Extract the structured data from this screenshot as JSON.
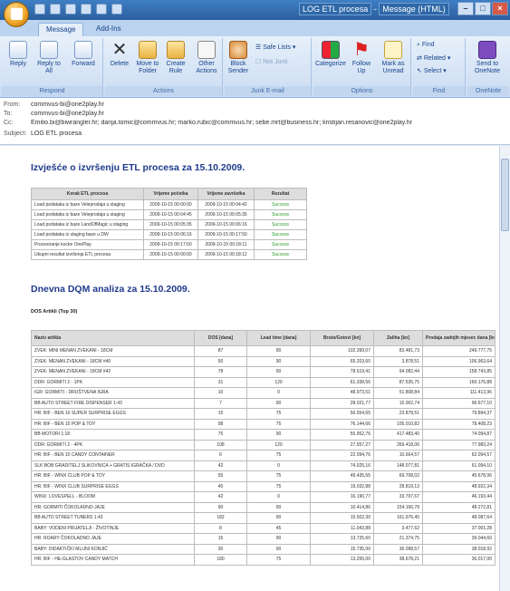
{
  "window": {
    "title": "LOG ETL procesa",
    "title_suffix": "Message (HTML)"
  },
  "tabs": [
    {
      "label": "Message"
    },
    {
      "label": "Add-Ins"
    }
  ],
  "ribbon": {
    "groups": {
      "respond": "Respond",
      "actions": "Actions",
      "junk": "Junk E-mail",
      "options": "Options",
      "find": "Find",
      "onenote": "OneNote"
    },
    "buttons": {
      "reply": "Reply",
      "reply_all": "Reply to All",
      "forward": "Forward",
      "delete": "Delete",
      "move_to_folder": "Move to Folder",
      "create_rule": "Create Rule",
      "other_actions": "Other Actions",
      "block_sender": "Block Sender",
      "safe_lists": "Safe Lists",
      "not_junk": "Not Junk",
      "categorize": "Categorize",
      "follow_up": "Follow Up",
      "mark_as_unread": "Mark as Unread",
      "find": "Find",
      "related": "Related",
      "select": "Select",
      "send_to_onenote": "Send to OneNote"
    }
  },
  "header": {
    "from_label": "From:",
    "from": "commvus-bi@one2play.hr",
    "to_label": "To:",
    "to": "commvus-bi@one2play.hr",
    "cc_label": "Cc:",
    "cc": "Emilio.bi@biwrangler.hr; darija.tomic@commvus.hr; marko.rubic@commvus.hr; sebe.mrt@business.hr; kristijan.resanovic@one2play.hr",
    "subject_label": "Subject:",
    "subject": "LOG ETL procesa"
  },
  "etl": {
    "title": "Izvješće o izvršenju ETL procesa za 15.10.2009.",
    "columns": [
      "Korak ETL procesa",
      "Vrijeme početka",
      "Vrijeme završetka",
      "Rezultat"
    ],
    "rows": [
      [
        "Load podataka iz baze Veleprodaja u staging",
        "2009-10-15 00:00:00",
        "2009-10-15 00:04:42",
        "Success"
      ],
      [
        "Load podataka iz baze Veleprodaja u staging",
        "2009-10-15 00:04:45",
        "2009-10-15 00:05:35",
        "Success"
      ],
      [
        "Load podataka iz baze LandOfMagic u staging",
        "2009-10-15 00:05:35",
        "2009-10-15 00:06:16",
        "Success"
      ],
      [
        "Load podataka iz staging baze u DW",
        "2009-10-15 00:06:16",
        "2009-10-15 00:17:50",
        "Success"
      ],
      [
        "Procesiranje kocke OnePlay",
        "2009-10-15 00:17:50",
        "2009-10-15 00:18:11",
        "Success"
      ],
      [
        "Ukupni rezultat izvršenja ETL procesa",
        "2009-10-15 00:00:00",
        "2009-10-15 00:18:12",
        "Success"
      ]
    ]
  },
  "dqm": {
    "title": "Dnevna DQM analiza za 15.10.2009.",
    "subtitle": "DOS Artikli (Top 30)",
    "columns": [
      "Naziv artikla",
      "DOS [dana]",
      "Lead time [dana]",
      "Bruto/Gotovi [kn]",
      "Zaliha [kn]",
      "Prodaja zadnjih mjesec dana [kn]"
    ],
    "rows": [
      [
        "ZVEK: MINI MENAN ZVEKANI - 18CM",
        "87",
        "90",
        "102.399,07",
        "83.481,73",
        "249.777,75"
      ],
      [
        "ZVEK: MENAN ZVEKANI - 18CM #40",
        "50",
        "90",
        "65.203,60",
        "3.878,51",
        "106.963,64"
      ],
      [
        "ZVEK: MENAN ZVEKANI - 18CM #42",
        "78",
        "90",
        "78.619,41",
        "94.082,44",
        "158.743,85"
      ],
      [
        "DDR: GORMITI 2 - 1PK",
        "31",
        "120",
        "61.338,56",
        "87.535,75",
        "160.176,88"
      ],
      [
        "IGR: GORMITI - DRUŠTVENA IGRA",
        "10",
        "0",
        "48.973,51",
        "51.808,84",
        "111.413,96"
      ],
      [
        "BB AUTO STREET FIRE DISPENSER 1:43",
        "7",
        "90",
        "28.021,77",
        "15.002,74",
        "96.677,10"
      ],
      [
        "HR: BIF - BEN 10 SUPER SURPRISE EGGS",
        "15",
        "75",
        "56.554,65",
        "23.878,51",
        "79.894,37"
      ],
      [
        "HR: BIF - BEN 10 POP & TOY",
        "98",
        "75",
        "76.144,66",
        "105.010,82",
        "78.408,23"
      ],
      [
        "BB MOTORI 1:18",
        "75",
        "90",
        "55.952,76",
        "417.483,40",
        "74.094,87"
      ],
      [
        "DDR: GORMITI 2 - 4PK",
        "108",
        "120",
        "27.557,27",
        "269.418,06",
        "77.983,24"
      ],
      [
        "HR: BIF - BEN 10 CANDY CONTAINER",
        "6",
        "75",
        "22.094,76",
        "10.664,57",
        "62.094,57"
      ],
      [
        "SLK BOB GRADITELJ SLIKOVNICA + GRATIS IGRAČKA / DVD",
        "42",
        "0",
        "74.925,16",
        "148.077,81",
        "61.094,10"
      ],
      [
        "HR: BIF - WINX CLUB POP & TOY",
        "55",
        "75",
        "49.435,55",
        "69.708,02",
        "45.678,96"
      ],
      [
        "HR: BIF - WINX CLUB SURPRISE EGGS",
        "40",
        "75",
        "19.032,88",
        "28.819,13",
        "48.922,34"
      ],
      [
        "WINX: LOVESPELL - BLOOM",
        "42",
        "0",
        "16.190,77",
        "33.797,67",
        "46.193,44"
      ],
      [
        "HR: GORMITI ČOKOLADNO JAJE",
        "90",
        "90",
        "10.414,86",
        "154.166,78",
        "48.272,81"
      ],
      [
        "BB AUTO STREET TUNERS 1:43",
        "182",
        "90",
        "15.502,30",
        "161.976,45",
        "48.087,64"
      ],
      [
        "BABY: VODENI PRIJATELJI - ŽIVOTINJE",
        "8",
        "45",
        "11.043,88",
        "3.477,62",
        "37.001,28"
      ],
      [
        "HR: ROARY ČOKOLADNO JAJE",
        "15",
        "90",
        "13.725,60",
        "21.374,75",
        "39.044,60"
      ],
      [
        "BABY: DIDAKTIČKI MLIJNI KONJIĆ",
        "30",
        "90",
        "15.735,00",
        "36.098,57",
        "38.018,92"
      ],
      [
        "HR: BIF - HE-GLASTOV CANDY MATCH",
        "180",
        "75",
        "13.255,00",
        "38.678,21",
        "36.017,00"
      ]
    ]
  }
}
